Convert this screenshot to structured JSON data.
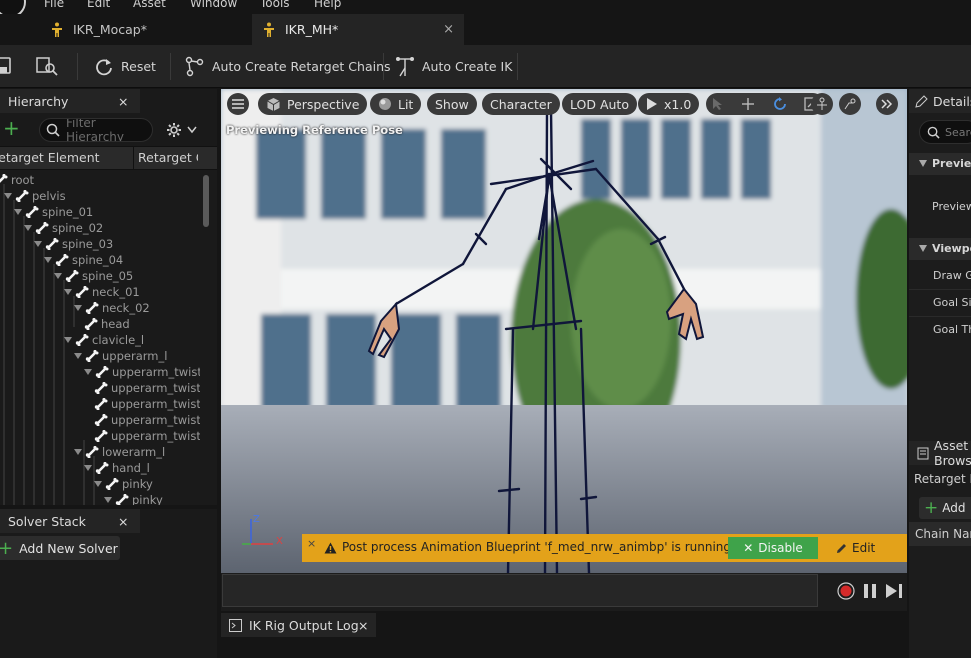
{
  "menu": [
    "File",
    "Edit",
    "Asset",
    "Window",
    "Tools",
    "Help"
  ],
  "tabs": [
    {
      "label": "IKR_Mocap*",
      "icon": "ik-rig-icon"
    },
    {
      "label": "IKR_MH*",
      "icon": "ik-rig-icon",
      "close": "×"
    }
  ],
  "toolbar": {
    "reset": "Reset",
    "auto_chains": "Auto Create Retarget Chains",
    "auto_ik": "Auto Create IK"
  },
  "hierarchy": {
    "title": "Hierarchy",
    "close": "×",
    "search_placeholder": "Filter Hierarchy",
    "col_element": "Retarget Element",
    "col_chain": "Retarget Chain",
    "rows": [
      "root",
      "pelvis",
      "spine_01",
      "spine_02",
      "spine_03",
      "spine_04",
      "spine_05",
      "neck_01",
      "neck_02",
      "head",
      "clavicle_l",
      "upperarm_l",
      "upperarm_twist",
      "upperarm_twist",
      "upperarm_twist",
      "upperarm_twist",
      "upperarm_twist",
      "lowerarm_l",
      "hand_l",
      "pinky",
      "pinky"
    ]
  },
  "solver": {
    "title": "Solver Stack",
    "close": "×",
    "add": "Add New Solver"
  },
  "viewport": {
    "perspective": "Perspective",
    "lit": "Lit",
    "show": "Show",
    "character": "Character",
    "lod": "LOD Auto",
    "speed": "x1.0",
    "preview_label": "Previewing Reference Pose",
    "axis_x": "X",
    "axis_z": "Z",
    "warning": "Post process Animation Blueprint 'f_med_nrw_animbp' is running.",
    "disable": "Disable",
    "edit": "Edit",
    "warn_close": "×"
  },
  "log": {
    "tab": "IK Rig Output Log",
    "close": "×"
  },
  "details": {
    "title": "Details",
    "search": "Search",
    "section_preview": "Preview",
    "row_preview": "Preview",
    "section_viewport": "Viewport",
    "row_draw_goals": "Draw Goals",
    "row_goal_size": "Goal Size",
    "row_goal_thickness": "Goal Thickness"
  },
  "asset": {
    "title": "Asset Browser",
    "retarget_root": "Retarget Root",
    "add": "Add",
    "chain_name": "Chain Name"
  },
  "colors": {
    "accent_green": "#3fa34a",
    "warning_yellow": "#e3a21a",
    "record_red": "#d42a2a",
    "skeleton": "#10163a"
  }
}
